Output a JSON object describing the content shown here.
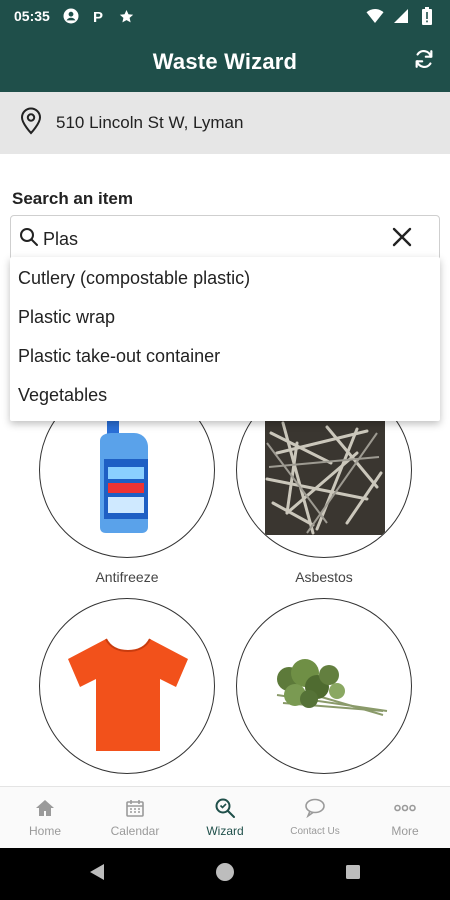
{
  "status_bar": {
    "time": "05:35"
  },
  "app_bar": {
    "title": "Waste Wizard",
    "refresh_icon": "refresh-icon"
  },
  "address": {
    "text": "510 Lincoln St W, Lyman",
    "icon": "location-pin-icon"
  },
  "search": {
    "label": "Search an item",
    "value": "Plas",
    "suggestions": [
      "Cutlery (compostable plastic)",
      "Plastic wrap",
      "Plastic take-out container",
      "Vegetables"
    ]
  },
  "items": [
    {
      "label": "Antifreeze"
    },
    {
      "label": "Asbestos"
    },
    {
      "label": ""
    },
    {
      "label": ""
    }
  ],
  "bottom_nav": [
    {
      "label": "Home",
      "icon": "home-icon"
    },
    {
      "label": "Calendar",
      "icon": "calendar-icon"
    },
    {
      "label": "Wizard",
      "icon": "wizard-search-icon",
      "active": true
    },
    {
      "label": "Contact Us",
      "icon": "chat-bubble-icon"
    },
    {
      "label": "More",
      "icon": "more-dots-icon"
    }
  ],
  "colors": {
    "primary": "#1f4f4a",
    "address_bg": "#e6e6e6",
    "inactive_nav": "#9a9a9a"
  }
}
